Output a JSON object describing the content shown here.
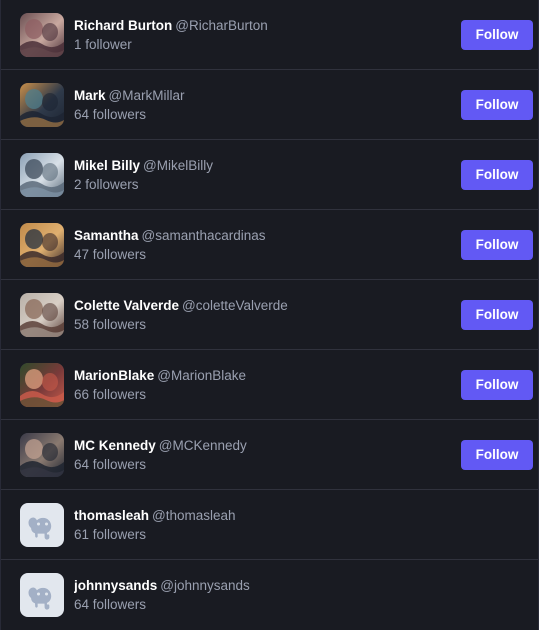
{
  "theme": {
    "background": "#191b22",
    "divider": "#30323d",
    "accent": "#6259f4",
    "name_color": "#ffffff",
    "muted_color": "#9aa0b0"
  },
  "list": {
    "follow_label": "Follow",
    "accounts": [
      {
        "display_name": "Richard Burton",
        "handle": "@RicharBurton",
        "followers": "1 follower",
        "avatar": "photo-avatar",
        "avatar_colors": [
          "#6b4f52",
          "#c9a9a0",
          "#4a2f38",
          "#8f5f63"
        ],
        "has_follow_button": true
      },
      {
        "display_name": "Mark",
        "handle": "@MarkMillar",
        "followers": "64 followers",
        "avatar": "photo-avatar",
        "avatar_colors": [
          "#c98f4a",
          "#2f3a4a",
          "#1d2533",
          "#4f7d8c"
        ],
        "has_follow_button": true
      },
      {
        "display_name": "Mikel Billy",
        "handle": "@MikelBilly",
        "followers": "2 followers",
        "avatar": "photo-avatar",
        "avatar_colors": [
          "#8ba0b5",
          "#d9e1e8",
          "#5a6a7a",
          "#3c4a5a"
        ],
        "has_follow_button": true
      },
      {
        "display_name": "Samantha",
        "handle": "@samanthacardinas",
        "followers": "47 followers",
        "avatar": "photo-avatar",
        "avatar_colors": [
          "#c08a4a",
          "#e0b070",
          "#3a2a2a",
          "#243040"
        ],
        "has_follow_button": true
      },
      {
        "display_name": "Colette Valverde",
        "handle": "@coletteValverde",
        "followers": "58 followers",
        "avatar": "photo-avatar",
        "avatar_colors": [
          "#b8b0a8",
          "#d8cfc6",
          "#5a3f38",
          "#8a6a5a"
        ],
        "has_follow_button": true
      },
      {
        "display_name": "MarionBlake",
        "handle": "@MarionBlake",
        "followers": "66 followers",
        "avatar": "photo-avatar",
        "avatar_colors": [
          "#2f4a2a",
          "#7a3a3a",
          "#c85a4a",
          "#e0a080"
        ],
        "has_follow_button": true
      },
      {
        "display_name": "MC Kennedy",
        "handle": "@MCKennedy",
        "followers": "64 followers",
        "avatar": "photo-avatar",
        "avatar_colors": [
          "#3a3a48",
          "#8a7a70",
          "#1f2430",
          "#c0a090"
        ],
        "has_follow_button": true
      },
      {
        "display_name": "thomasleah",
        "handle": "@thomasleah",
        "followers": "61 followers",
        "avatar": "default-elephant-avatar",
        "avatar_colors": [
          "#e2e7ee",
          "#a3b0c6"
        ],
        "has_follow_button": false
      },
      {
        "display_name": "johnnysands",
        "handle": "@johnnysands",
        "followers": "64 followers",
        "avatar": "default-elephant-avatar",
        "avatar_colors": [
          "#e2e7ee",
          "#a3b0c6"
        ],
        "has_follow_button": false
      }
    ]
  }
}
